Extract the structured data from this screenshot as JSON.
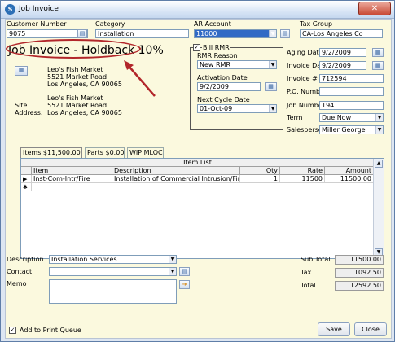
{
  "window": {
    "title": "Job Invoice",
    "close_glyph": "✕"
  },
  "header": {
    "customer_number_label": "Customer Number",
    "customer_number": "9075",
    "category_label": "Category",
    "category": "Installation",
    "ar_account_label": "AR Account",
    "ar_account": "11000",
    "tax_group_label": "Tax Group",
    "tax_group": "CA-Los Angeles Co"
  },
  "banner": {
    "text": "Job Invoice - Holdback 10%"
  },
  "bill_to": {
    "line1": "Leo's Fish Market",
    "line2": "5521 Market Road",
    "line3": "Los Angeles, CA  90065"
  },
  "site": {
    "label1": "Site",
    "label2": "Address:",
    "line1": "Leo's Fish Market",
    "line2": "5521 Market Road",
    "line3": "Los Angeles, CA  90065"
  },
  "rmr": {
    "bill_rmr_label": "Bill RMR",
    "bill_rmr_checked": "✓",
    "rmr_reason_label": "RMR Reason",
    "rmr_reason": "New RMR",
    "activation_date_label": "Activation Date",
    "activation_date": "9/2/2009",
    "next_cycle_date_label": "Next Cycle Date",
    "next_cycle_date": "01-Oct-09"
  },
  "details": {
    "aging_date_label": "Aging Date",
    "aging_date": "9/2/2009",
    "invoice_date_label": "Invoice Date",
    "invoice_date": "9/2/2009",
    "invoice_no_label": "Invoice #",
    "invoice_no": "712594",
    "po_number_label": "P.O. Number",
    "po_number": "",
    "job_number_label": "Job Number",
    "job_number": "194",
    "term_label": "Term",
    "term": "Due Now",
    "salesperson_label": "Salesperson",
    "salesperson": "Miller George"
  },
  "tabs": [
    {
      "label": "Items $11,500.00"
    },
    {
      "label": "Parts $0.00"
    },
    {
      "label": "WIP MLOC"
    }
  ],
  "item_list": {
    "title": "Item List",
    "columns": [
      "Item",
      "Description",
      "Qty",
      "Rate",
      "Amount"
    ],
    "rows": [
      {
        "item": "Inst-Com-Intr/Fire",
        "description": "Installation of Commercial Intrusion/Fire System",
        "qty": "1",
        "rate": "11500",
        "amount": "11500.00"
      }
    ],
    "row_marker": "▶",
    "new_marker": "✱"
  },
  "footer": {
    "description_label": "Description",
    "description": "Installation Services",
    "contact_label": "Contact",
    "contact": "",
    "memo_label": "Memo",
    "memo": "",
    "subtotal_label": "Sub Total",
    "subtotal": "11500.00",
    "tax_label": "Tax",
    "tax": "1092.50",
    "total_label": "Total",
    "total": "12592.50",
    "print_queue_label": "Add to Print Queue",
    "print_queue_checked": "✓",
    "save_label": "Save",
    "close_label": "Close"
  },
  "colors": {
    "form_bg": "#fbf9de",
    "highlight": "#b2262a",
    "selection": "#316ac5"
  },
  "icons": [
    "app-icon",
    "calendar-icon",
    "lookup-icon",
    "map-icon",
    "close-icon",
    "chevron-down-icon",
    "arrow-icon"
  ]
}
